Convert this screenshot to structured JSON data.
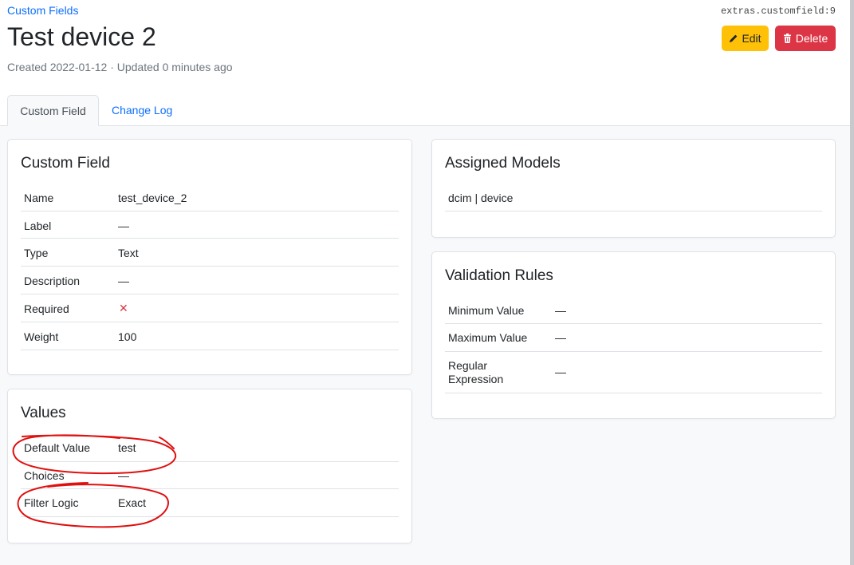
{
  "breadcrumb": "Custom Fields",
  "object_id": "extras.customfield:9",
  "title": "Test device 2",
  "meta": "Created 2022-01-12 · Updated 0 minutes ago",
  "buttons": {
    "edit": "Edit",
    "delete": "Delete"
  },
  "tabs": [
    {
      "label": "Custom Field",
      "active": true
    },
    {
      "label": "Change Log",
      "active": false
    }
  ],
  "custom_field_card": {
    "title": "Custom Field",
    "rows": [
      {
        "key": "Name",
        "value": "test_device_2"
      },
      {
        "key": "Label",
        "value": "—"
      },
      {
        "key": "Type",
        "value": "Text"
      },
      {
        "key": "Description",
        "value": "—"
      },
      {
        "key": "Required",
        "value": "✕"
      },
      {
        "key": "Weight",
        "value": "100"
      }
    ]
  },
  "values_card": {
    "title": "Values",
    "rows": [
      {
        "key": "Default Value",
        "value": "test"
      },
      {
        "key": "Choices",
        "value": "—"
      },
      {
        "key": "Filter Logic",
        "value": "Exact"
      }
    ]
  },
  "assigned_models_card": {
    "title": "Assigned Models",
    "models": [
      "dcim | device"
    ]
  },
  "validation_card": {
    "title": "Validation Rules",
    "rows": [
      {
        "key": "Minimum Value",
        "value": "—"
      },
      {
        "key": "Maximum Value",
        "value": "—"
      },
      {
        "key_line1": "Regular",
        "key_line2": "Expression",
        "value": "—"
      }
    ]
  },
  "colors": {
    "link": "#0d6efd",
    "edit_button": "#ffc107",
    "delete_button": "#dc3545",
    "required_false_icon": "#dc3545",
    "annotation": "#e01010"
  },
  "icons": {
    "edit": "pencil-icon",
    "delete": "trash-icon",
    "required": "close-icon"
  }
}
